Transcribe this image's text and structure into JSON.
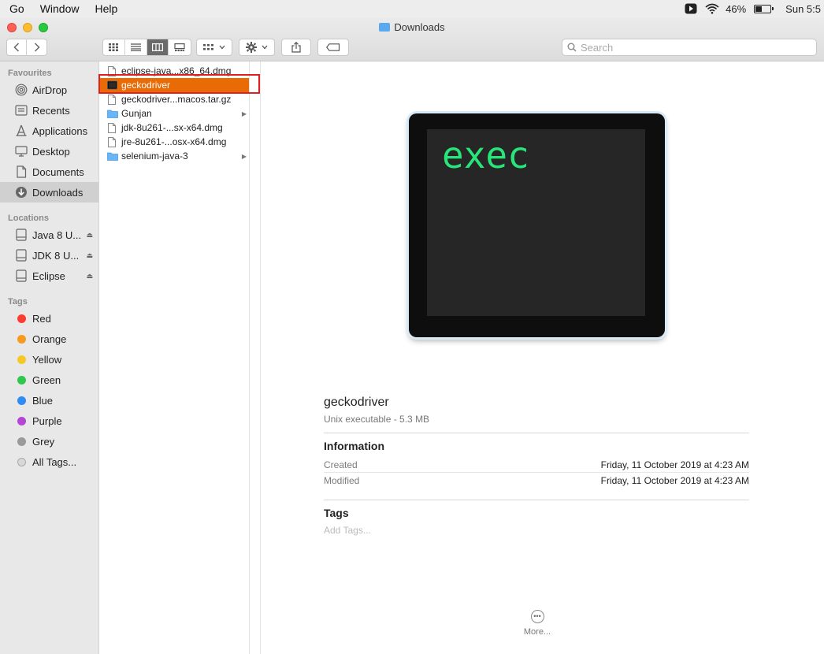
{
  "menubar": {
    "items": [
      "Go",
      "Window",
      "Help"
    ],
    "battery": "46%",
    "battery_level": 0.46,
    "clock": "Sun 5:5"
  },
  "window": {
    "title": "Downloads"
  },
  "toolbar": {
    "search_placeholder": "Search"
  },
  "sidebar": {
    "favourites_label": "Favourites",
    "favourites": [
      "AirDrop",
      "Recents",
      "Applications",
      "Desktop",
      "Documents",
      "Downloads"
    ],
    "locations_label": "Locations",
    "locations": [
      "Java 8 U...",
      "JDK 8 U...",
      "Eclipse"
    ],
    "tags_label": "Tags",
    "tags": [
      {
        "name": "Red",
        "color": "#fe3b30"
      },
      {
        "name": "Orange",
        "color": "#f79a1e"
      },
      {
        "name": "Yellow",
        "color": "#f7c824"
      },
      {
        "name": "Green",
        "color": "#2dc84d"
      },
      {
        "name": "Blue",
        "color": "#2e8cf2"
      },
      {
        "name": "Purple",
        "color": "#b445d6"
      },
      {
        "name": "Grey",
        "color": "#9a9a9a"
      }
    ],
    "all_tags": "All Tags..."
  },
  "files": [
    {
      "name": "eclipse-java...x86_64.dmg",
      "kind": "file"
    },
    {
      "name": "geckodriver",
      "kind": "exec",
      "selected": true
    },
    {
      "name": "geckodriver...macos.tar.gz",
      "kind": "file"
    },
    {
      "name": "Gunjan",
      "kind": "folder"
    },
    {
      "name": "jdk-8u261-...sx-x64.dmg",
      "kind": "file"
    },
    {
      "name": "jre-8u261-...osx-x64.dmg",
      "kind": "file"
    },
    {
      "name": "selenium-java-3",
      "kind": "folder"
    }
  ],
  "preview": {
    "icon_text": "exec",
    "name": "geckodriver",
    "kind": "Unix executable - 5.3 MB",
    "information_label": "Information",
    "created_label": "Created",
    "created_value": "Friday, 11 October 2019 at 4:23 AM",
    "modified_label": "Modified",
    "modified_value": "Friday, 11 October 2019 at 4:23 AM",
    "tags_label": "Tags",
    "add_tags": "Add Tags...",
    "more_label": "More..."
  }
}
